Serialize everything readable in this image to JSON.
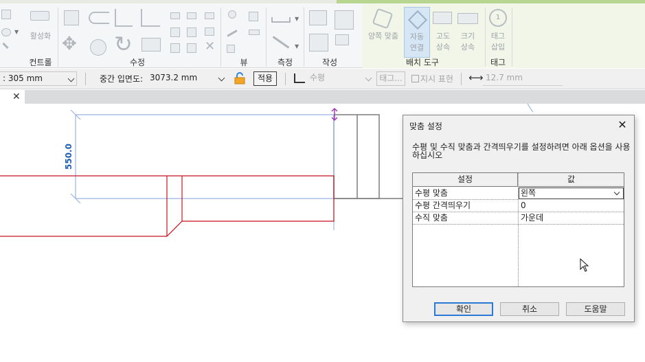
{
  "ribbon": {
    "panels": [
      {
        "label": "컨트롤"
      },
      {
        "label": "수정"
      },
      {
        "label": "뷰"
      },
      {
        "label": "측정"
      },
      {
        "label": "작성"
      },
      {
        "label": "배치 도구"
      },
      {
        "label": "태그"
      }
    ],
    "buttons": {
      "activate": "활성화",
      "align_both": "양쪽 맞춤",
      "auto_connect": [
        "자동",
        "연결"
      ],
      "elevation_up": [
        "고도",
        "상속"
      ],
      "size_up": [
        "크기",
        "상속"
      ],
      "tag_insert": [
        "태그",
        "삽입"
      ],
      "tag_badge": "1"
    }
  },
  "options_bar": {
    "field1_value": ": 305 mm",
    "mid_elev_label": "중간 입면도:",
    "mid_elev_value": "3073.2 mm",
    "apply_label": "적용",
    "orientation_value": "수평",
    "tag_button": "태그...",
    "leader_label": "지시 표현",
    "leader_length": "12.7 mm"
  },
  "tabs": {
    "close_glyph": "✕"
  },
  "canvas": {
    "dimension_text": "550.0"
  },
  "dialog": {
    "title": "맞춤 설정",
    "close_glyph": "✕",
    "instructions": "수평 및 수직 맞춤과 간격띄우기를 설정하려면 아래 옵션을 사용하십시오",
    "grid": {
      "col_setting": "설정",
      "col_value": "값",
      "rows": [
        {
          "setting": "수평 맞춤",
          "value": "왼쪽"
        },
        {
          "setting": "수평 간격띄우기",
          "value": "0"
        },
        {
          "setting": "수직 맞춤",
          "value": "가운데"
        }
      ]
    },
    "ok_label": "확인",
    "cancel_label": "취소",
    "help_label": "도움말"
  },
  "colors": {
    "drawing_red": "#c8101a",
    "dimension_blue": "#1f5fb5",
    "guide_blue": "#9bb4e6",
    "gripper_magenta": "#a23ab0",
    "default_button_border": "#2a79d6"
  }
}
